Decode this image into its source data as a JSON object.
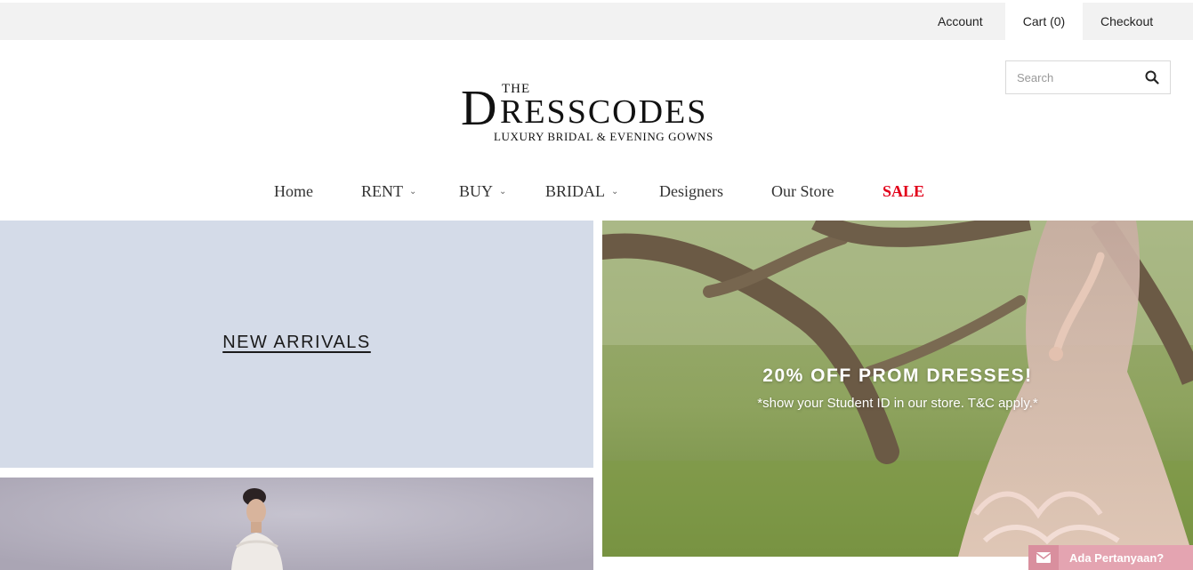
{
  "topbar": {
    "account": "Account",
    "cart": "Cart (0)",
    "checkout": "Checkout"
  },
  "search": {
    "placeholder": "Search",
    "icon": "search-icon"
  },
  "logo": {
    "the": "THE",
    "initial": "D",
    "rest": "RESSCODES",
    "tagline": "LUXURY BRIDAL & EVENING GOWNS"
  },
  "nav": {
    "items": [
      {
        "label": "Home",
        "dropdown": false
      },
      {
        "label": "RENT",
        "dropdown": true
      },
      {
        "label": "BUY",
        "dropdown": true
      },
      {
        "label": "BRIDAL",
        "dropdown": true
      },
      {
        "label": "Designers",
        "dropdown": false
      },
      {
        "label": "Our Store",
        "dropdown": false
      },
      {
        "label": "SALE",
        "dropdown": false
      }
    ],
    "sale_color": "#e2001a"
  },
  "tiles": {
    "new_arrivals": "NEW ARRIVALS"
  },
  "hero": {
    "headline": "20% OFF PROM DRESSES!",
    "subtext": "*show your Student ID in our store. T&C apply.*"
  },
  "chat": {
    "label": "Ada Pertanyaan?",
    "icon": "envelope-icon",
    "color": "#e4a4b1"
  }
}
